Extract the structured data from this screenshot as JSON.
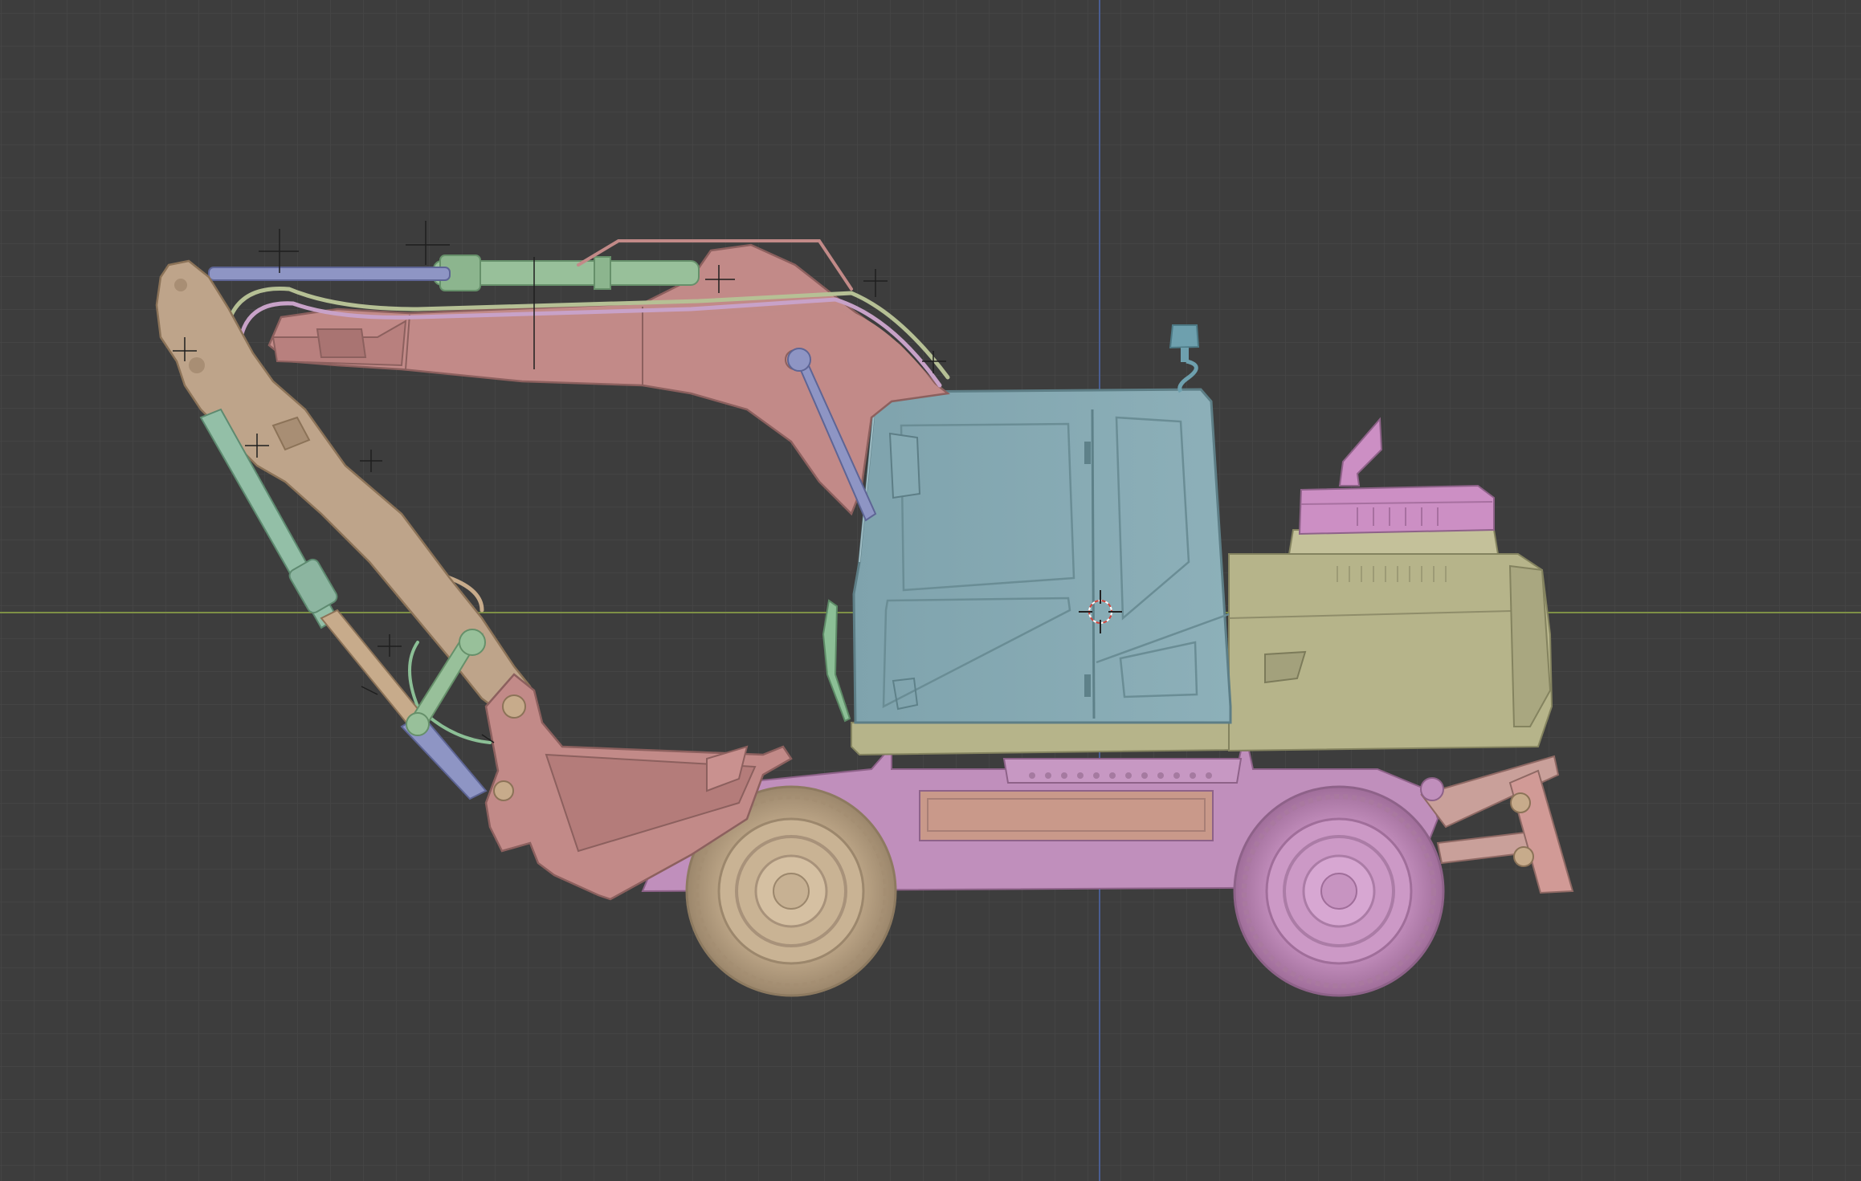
{
  "viewport": {
    "view": "side-orthographic",
    "shading": "solid-random-color",
    "grid": true,
    "axes": [
      "x-axis-line",
      "z-axis-line"
    ],
    "cursor": "3d-cursor"
  },
  "colors": {
    "background": "#3d3d3d",
    "grid_line": "#474747",
    "x_axis": "#7e9046",
    "z_axis": "#4a5e92",
    "boom_pink": "#c28a88",
    "arm_tan": "#bea48a",
    "cab_teal": "#86aab3",
    "body_olive": "#b6b48a",
    "chassis_magenta": "#c08fbc",
    "cylinder_green": "#98c09a",
    "cylinder_blue": "#8e95c4",
    "tire_tan": "#c2ab8c",
    "tire_pink": "#c893c2"
  },
  "scene": {
    "model": "wheeled-excavator",
    "parts": [
      "boom",
      "boom-cylinder",
      "arm",
      "arm-cylinder",
      "bucket",
      "bucket-cylinder",
      "bucket-linkage",
      "hydraulic-hoses",
      "cab",
      "beacon-light",
      "engine-housing",
      "exhaust-stack",
      "undercarriage",
      "front-wheel",
      "rear-wheel",
      "stabilizer",
      "side-mirror"
    ]
  }
}
